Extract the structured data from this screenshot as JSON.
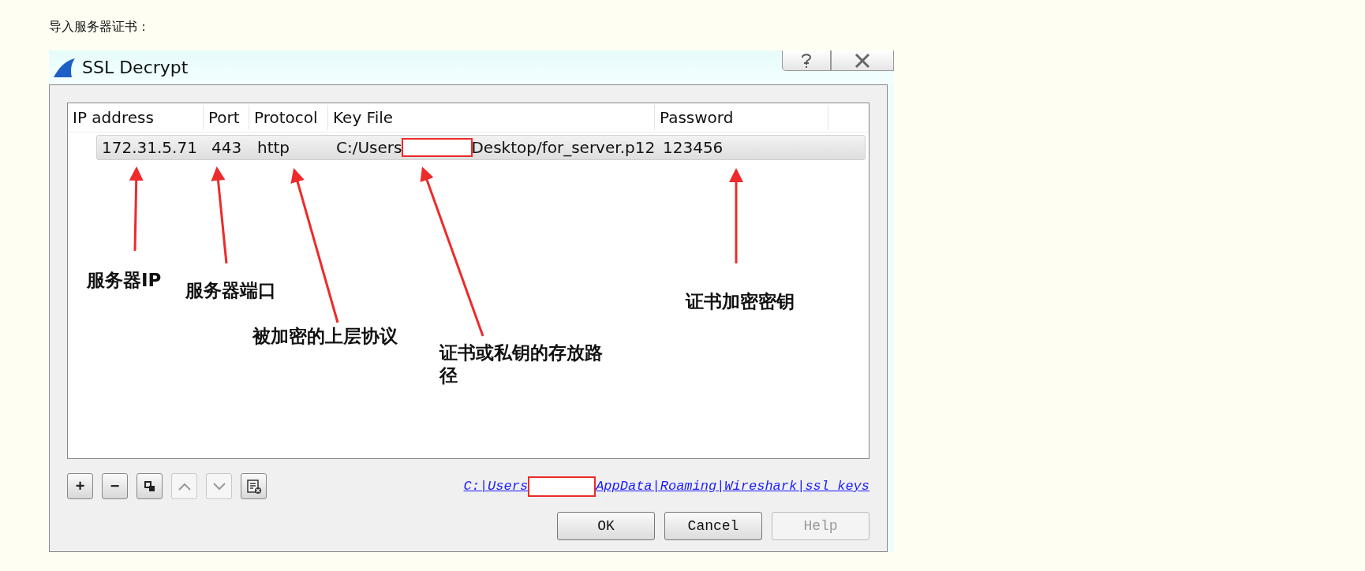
{
  "heading": "导入服务器证书：",
  "dialog": {
    "title": "SSL Decrypt",
    "columns": [
      "IP address",
      "Port",
      "Protocol",
      "Key File",
      "Password"
    ],
    "rows": [
      {
        "ip": "172.31.5.71",
        "port": "443",
        "protocol": "http",
        "key_file_parts": [
          "C:/Users",
          "Desktop/for_server.p12"
        ],
        "password": "123456",
        "selected": true
      }
    ],
    "toolbar": [
      {
        "kind": "add",
        "label": "+",
        "disabled": false
      },
      {
        "kind": "remove",
        "label": "−",
        "disabled": false
      },
      {
        "kind": "copy",
        "disabled": false
      },
      {
        "kind": "up",
        "disabled": true
      },
      {
        "kind": "down",
        "disabled": true
      },
      {
        "kind": "clear",
        "disabled": false
      }
    ],
    "path_link_parts": [
      "C:|Users",
      "AppData|Roaming|Wireshark|ssl_keys"
    ],
    "buttons": [
      {
        "label": "OK",
        "disabled": false
      },
      {
        "label": "Cancel",
        "disabled": false
      },
      {
        "label": "Help",
        "disabled": true
      }
    ]
  },
  "annotations": [
    {
      "text": "服务器IP"
    },
    {
      "text": "服务器端口"
    },
    {
      "text": "被加密的上层协议"
    },
    {
      "text": "证书或私钥的存放路径"
    },
    {
      "text": "证书加密密钥"
    }
  ]
}
